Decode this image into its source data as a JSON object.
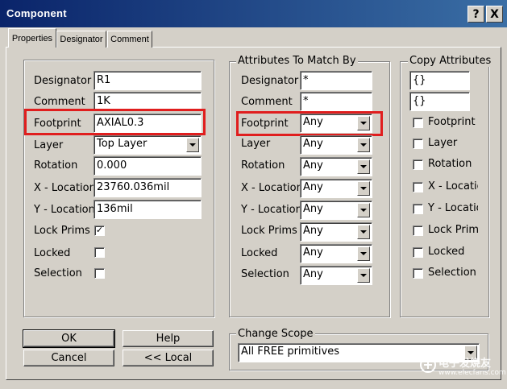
{
  "window": {
    "title": "Component",
    "help_label": "?",
    "close_label": "X"
  },
  "tabs": [
    {
      "label": "Properties",
      "active": true
    },
    {
      "label": "Designator",
      "active": false
    },
    {
      "label": "Comment",
      "active": false
    }
  ],
  "properties": {
    "designator": {
      "label": "Designator",
      "value": "R1"
    },
    "comment": {
      "label": "Comment",
      "value": "1K"
    },
    "footprint": {
      "label": "Footprint",
      "value": "AXIAL0.3"
    },
    "layer": {
      "label": "Layer",
      "value": "Top Layer"
    },
    "rotation": {
      "label": "Rotation",
      "value": "0.000"
    },
    "x_location": {
      "label": "X - Location",
      "value": "23760.036mil"
    },
    "y_location": {
      "label": "Y - Location",
      "value": "136mil"
    },
    "lock_prims": {
      "label": "Lock Prims",
      "checked": true
    },
    "locked": {
      "label": "Locked",
      "checked": false
    },
    "selection": {
      "label": "Selection",
      "checked": false
    }
  },
  "attributes_to_match": {
    "title": "Attributes To Match By",
    "designator": {
      "label": "Designator",
      "value": "*"
    },
    "comment": {
      "label": "Comment",
      "value": "*"
    },
    "footprint": {
      "label": "Footprint",
      "value": "Any"
    },
    "layer": {
      "label": "Layer",
      "value": "Any"
    },
    "rotation": {
      "label": "Rotation",
      "value": "Any"
    },
    "x_location": {
      "label": "X - Location",
      "value": "Any"
    },
    "y_location": {
      "label": "Y - Location",
      "value": "Any"
    },
    "lock_prims": {
      "label": "Lock Prims",
      "value": "Any"
    },
    "locked": {
      "label": "Locked",
      "value": "Any"
    },
    "selection": {
      "label": "Selection",
      "value": "Any"
    }
  },
  "copy_attributes": {
    "title": "Copy Attributes",
    "field1": "{}",
    "field2": "{}",
    "footprint": {
      "label": "Footprint",
      "checked": false
    },
    "layer": {
      "label": "Layer",
      "checked": false
    },
    "rotation": {
      "label": "Rotation",
      "checked": false
    },
    "x_location": {
      "label": "X - Location",
      "checked": false
    },
    "y_location": {
      "label": "Y - Location",
      "checked": false
    },
    "lock_prims": {
      "label": "Lock Prims",
      "checked": false
    },
    "locked": {
      "label": "Locked",
      "checked": false
    },
    "selection": {
      "label": "Selection",
      "checked": false
    }
  },
  "buttons": {
    "ok": "OK",
    "help": "Help",
    "cancel": "Cancel",
    "local": "<< Local"
  },
  "change_scope": {
    "title": "Change Scope",
    "value": "All FREE primitives"
  },
  "watermark": {
    "brand": "电子发烧友",
    "url": "www.elecfans.com"
  },
  "colors": {
    "titlebar_start": "#0a246a",
    "titlebar_end": "#3a6ea5",
    "highlight_box": "#e01e1e",
    "face": "#d4d0c8"
  }
}
